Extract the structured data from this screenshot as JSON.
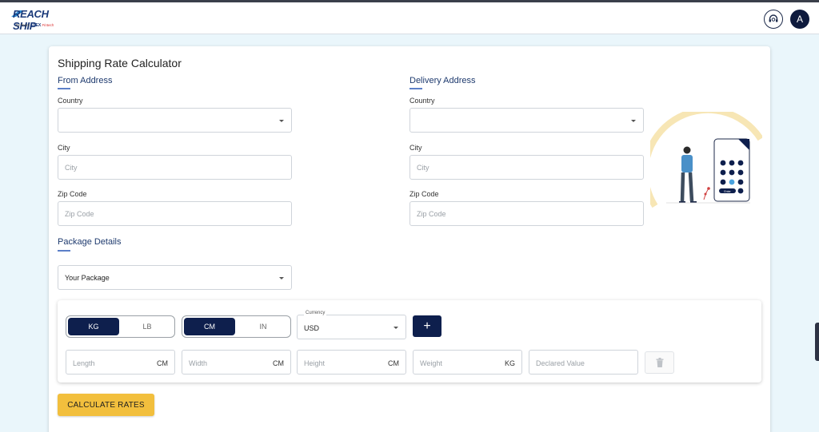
{
  "brand": {
    "logo_main": "REACH SHIP",
    "logo_by": "by Team",
    "logo_team": "ELEX",
    "logo_tag": "Fintech"
  },
  "header": {
    "avatar_letter": "A"
  },
  "page": {
    "title": "Shipping Rate Calculator"
  },
  "from_address": {
    "section_title": "From Address",
    "country_label": "Country",
    "country_value": "",
    "city_label": "City",
    "city_placeholder": "City",
    "zip_label": "Zip Code",
    "zip_placeholder": "Zip Code"
  },
  "delivery_address": {
    "section_title": "Delivery Address",
    "country_label": "Country",
    "country_value": "",
    "city_label": "City",
    "city_placeholder": "City",
    "zip_label": "Zip Code",
    "zip_placeholder": "Zip Code"
  },
  "package": {
    "section_title": "Package Details",
    "package_select": "Your Package",
    "weight_unit_options": [
      "KG",
      "LB"
    ],
    "weight_unit_selected": "KG",
    "dim_unit_options": [
      "CM",
      "IN"
    ],
    "dim_unit_selected": "CM",
    "currency_label": "Currency",
    "currency_value": "USD",
    "add_label": "+",
    "length_placeholder": "Length",
    "length_unit": "CM",
    "width_placeholder": "Width",
    "width_unit": "CM",
    "height_placeholder": "Height",
    "height_unit": "CM",
    "weight_placeholder": "Weight",
    "weight_unit": "KG",
    "declared_placeholder": "Declared Value"
  },
  "actions": {
    "calculate_label": "CALCULATE RATES"
  },
  "illustration": {
    "keypad_enter": "Enter"
  },
  "colors": {
    "navy": "#0e1f4d",
    "accent_yellow": "#f2bf3d",
    "page_bg": "#eaf6fb",
    "section_title": "#1e3a6e"
  }
}
